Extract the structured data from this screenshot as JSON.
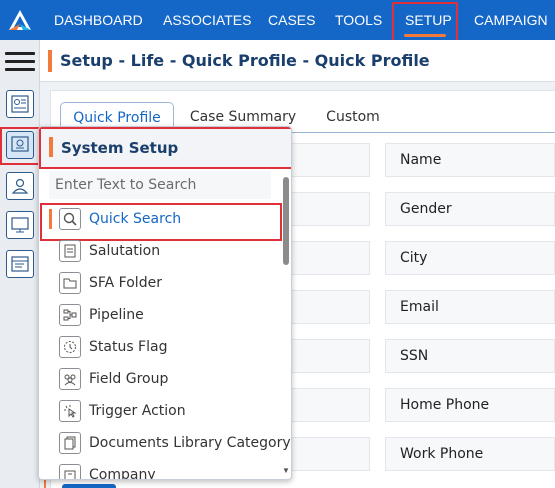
{
  "nav": {
    "items": [
      "DASHBOARD",
      "ASSOCIATES",
      "CASES",
      "TOOLS",
      "SETUP",
      "CAMPAIGN"
    ],
    "active": "SETUP"
  },
  "header": {
    "title": "Setup - Life - Quick Profile - Quick Profile"
  },
  "tabs": [
    "Quick Profile",
    "Case Summary",
    "Custom"
  ],
  "fields": [
    "Name",
    "Gender",
    "City",
    "Email",
    "SSN",
    "Home Phone",
    "Work Phone"
  ],
  "dropdown": {
    "title": "System Setup",
    "search_placeholder": "Enter Text to Search",
    "items": [
      {
        "label": "Quick Search",
        "icon": "magnifier-icon"
      },
      {
        "label": "Salutation",
        "icon": "document-icon"
      },
      {
        "label": "SFA Folder",
        "icon": "folder-icon"
      },
      {
        "label": "Pipeline",
        "icon": "pipeline-icon"
      },
      {
        "label": "Status Flag",
        "icon": "status-flag-icon"
      },
      {
        "label": "Field Group",
        "icon": "group-icon"
      },
      {
        "label": "Trigger Action",
        "icon": "pointer-click-icon"
      },
      {
        "label": "Documents Library Category",
        "icon": "documents-icon"
      },
      {
        "label": "Company",
        "icon": "company-icon"
      }
    ],
    "selected": "Quick Search"
  },
  "colors": {
    "nav_bg": "#1467c6",
    "accent": "#f27a3c",
    "highlight": "#e0303a",
    "title": "#1b3f6c"
  }
}
